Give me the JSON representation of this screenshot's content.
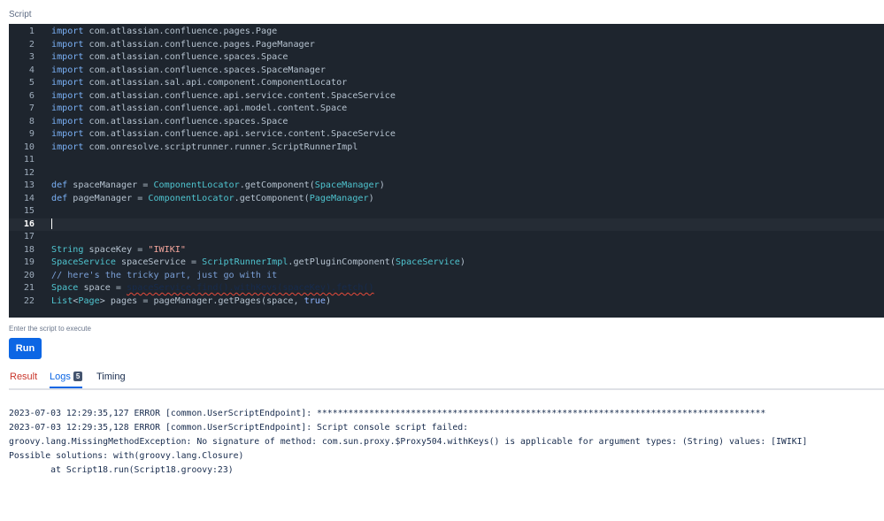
{
  "section_label": "Script",
  "editor": {
    "lines": [
      {
        "n": "1",
        "tokens": [
          [
            "kw",
            "import"
          ],
          [
            "ident",
            " com.atlassian.confluence.pages.Page"
          ]
        ]
      },
      {
        "n": "2",
        "tokens": [
          [
            "kw",
            "import"
          ],
          [
            "ident",
            " com.atlassian.confluence.pages.PageManager"
          ]
        ]
      },
      {
        "n": "3",
        "tokens": [
          [
            "kw",
            "import"
          ],
          [
            "ident",
            " com.atlassian.confluence.spaces.Space"
          ]
        ]
      },
      {
        "n": "4",
        "tokens": [
          [
            "kw",
            "import"
          ],
          [
            "ident",
            " com.atlassian.confluence.spaces.SpaceManager"
          ]
        ]
      },
      {
        "n": "5",
        "tokens": [
          [
            "kw",
            "import"
          ],
          [
            "ident",
            " com.atlassian.sal.api.component.ComponentLocator"
          ]
        ]
      },
      {
        "n": "6",
        "tokens": [
          [
            "kw",
            "import"
          ],
          [
            "ident",
            " com.atlassian.confluence.api.service.content.SpaceService"
          ]
        ]
      },
      {
        "n": "7",
        "tokens": [
          [
            "kw",
            "import"
          ],
          [
            "ident",
            " com.atlassian.confluence.api.model.content.Space"
          ]
        ]
      },
      {
        "n": "8",
        "tokens": [
          [
            "kw",
            "import"
          ],
          [
            "ident",
            " com.atlassian.confluence.spaces.Space"
          ]
        ]
      },
      {
        "n": "9",
        "tokens": [
          [
            "kw",
            "import"
          ],
          [
            "ident",
            " com.atlassian.confluence.api.service.content.SpaceService"
          ]
        ]
      },
      {
        "n": "10",
        "tokens": [
          [
            "kw",
            "import"
          ],
          [
            "ident",
            " com.onresolve.scriptrunner.runner.ScriptRunnerImpl"
          ]
        ]
      },
      {
        "n": "11",
        "tokens": []
      },
      {
        "n": "12",
        "tokens": []
      },
      {
        "n": "13",
        "tokens": [
          [
            "kw",
            "def"
          ],
          [
            "ident",
            " spaceManager = "
          ],
          [
            "cls",
            "ComponentLocator"
          ],
          [
            "ident",
            ".getComponent("
          ],
          [
            "cls",
            "SpaceManager"
          ],
          [
            "ident",
            ")"
          ]
        ]
      },
      {
        "n": "14",
        "tokens": [
          [
            "kw",
            "def"
          ],
          [
            "ident",
            " pageManager = "
          ],
          [
            "cls",
            "ComponentLocator"
          ],
          [
            "ident",
            ".getComponent("
          ],
          [
            "cls",
            "PageManager"
          ],
          [
            "ident",
            ")"
          ]
        ]
      },
      {
        "n": "15",
        "tokens": []
      },
      {
        "n": "16",
        "tokens": [
          [
            "cursor",
            ""
          ]
        ],
        "active": true
      },
      {
        "n": "17",
        "tokens": []
      },
      {
        "n": "18",
        "tokens": [
          [
            "cls",
            "String"
          ],
          [
            "ident",
            " spaceKey = "
          ],
          [
            "str",
            "\"IWIKI\""
          ]
        ]
      },
      {
        "n": "19",
        "tokens": [
          [
            "cls",
            "SpaceService"
          ],
          [
            "ident",
            " spaceService = "
          ],
          [
            "cls",
            "ScriptRunnerImpl"
          ],
          [
            "ident",
            ".getPluginComponent("
          ],
          [
            "cls",
            "SpaceService"
          ],
          [
            "ident",
            ")"
          ]
        ]
      },
      {
        "n": "20",
        "tokens": [
          [
            "cmt",
            "// here's the tricky part, just go with it"
          ]
        ]
      },
      {
        "n": "21",
        "tokens": [
          [
            "cls",
            "Space"
          ],
          [
            "ident",
            " space = "
          ],
          [
            "squiggle",
            "spaceService.find().withKeys(spaceKey).fetch()"
          ]
        ]
      },
      {
        "n": "22",
        "tokens": [
          [
            "cls",
            "List"
          ],
          [
            "ident",
            "<"
          ],
          [
            "cls",
            "Page"
          ],
          [
            "ident",
            "> pages = pageManager.getPages(space, "
          ],
          [
            "bool",
            "true"
          ],
          [
            "ident",
            ")"
          ]
        ]
      }
    ]
  },
  "hint": "Enter the script to execute",
  "run_button": "Run",
  "tabs": {
    "result": "Result",
    "logs": "Logs",
    "logs_count": "5",
    "timing": "Timing"
  },
  "log_lines": [
    "2023-07-03 12:29:35,127 ERROR [common.UserScriptEndpoint]: **************************************************************************************",
    "2023-07-03 12:29:35,128 ERROR [common.UserScriptEndpoint]: Script console script failed:",
    "groovy.lang.MissingMethodException: No signature of method: com.sun.proxy.$Proxy504.withKeys() is applicable for argument types: (String) values: [IWIKI]",
    "Possible solutions: with(groovy.lang.Closure)",
    "        at Script18.run(Script18.groovy:23)"
  ],
  "colors": {
    "editor_bg": "#1e252e",
    "run_button": "#0c66e4",
    "result_tab": "#c9372c",
    "active_tab": "#0c66e4"
  }
}
